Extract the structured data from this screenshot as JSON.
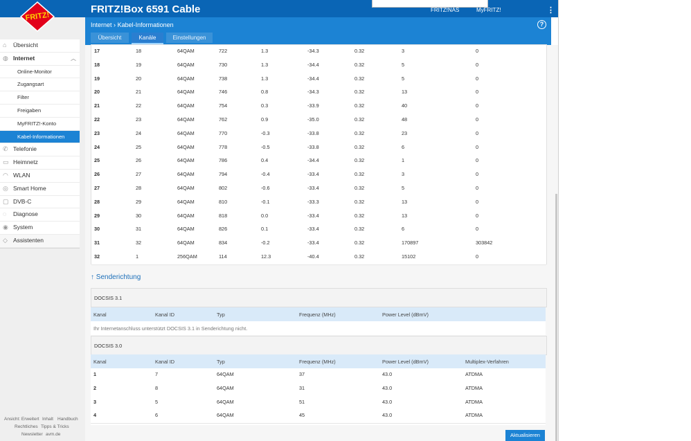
{
  "app": {
    "title": "FRITZ!Box 6591 Cable",
    "logo_text": "FRITZ!"
  },
  "header": {
    "fritznas": "FRITZ!NAS",
    "myfritz": "MyFRITZ!",
    "menu_icon": "⋮"
  },
  "breadcrumb": {
    "parent": "Internet",
    "separator": "›",
    "current": "Kabel-Informationen"
  },
  "help_label": "?",
  "tabs": [
    {
      "label": "Übersicht"
    },
    {
      "label": "Kanäle"
    },
    {
      "label": "Einstellungen"
    }
  ],
  "sidebar": {
    "items": [
      {
        "label": "Übersicht",
        "icon": "home-icon"
      },
      {
        "label": "Internet",
        "icon": "globe-icon"
      },
      {
        "label": "Online-Monitor"
      },
      {
        "label": "Zugangsart"
      },
      {
        "label": "Filter"
      },
      {
        "label": "Freigaben"
      },
      {
        "label": "MyFRITZ!-Konto"
      },
      {
        "label": "Kabel-Informationen"
      },
      {
        "label": "Telefonie",
        "icon": "phone-icon"
      },
      {
        "label": "Heimnetz",
        "icon": "network-icon"
      },
      {
        "label": "WLAN",
        "icon": "wifi-icon"
      },
      {
        "label": "Smart Home",
        "icon": "smart-home-icon"
      },
      {
        "label": "DVB-C",
        "icon": "tv-icon"
      },
      {
        "label": "Diagnose",
        "icon": "diagnose-icon"
      },
      {
        "label": "System",
        "icon": "system-icon"
      },
      {
        "label": "Assistenten",
        "icon": "wizard-icon"
      }
    ],
    "footer": {
      "ansicht": "Ansicht: Erweitert",
      "inhalt": "Inhalt",
      "handbuch": "Handbuch",
      "rechtliches": "Rechtliches",
      "tipps": "Tipps & Tricks",
      "newsletter": "Newsletter",
      "avm": "avm.de"
    }
  },
  "downstream": {
    "rows": [
      [
        "17",
        "18",
        "64QAM",
        "722",
        "1.3",
        "-34.3",
        "0.32",
        "3",
        "0"
      ],
      [
        "18",
        "19",
        "64QAM",
        "730",
        "1.3",
        "-34.4",
        "0.32",
        "5",
        "0"
      ],
      [
        "19",
        "20",
        "64QAM",
        "738",
        "1.3",
        "-34.4",
        "0.32",
        "5",
        "0"
      ],
      [
        "20",
        "21",
        "64QAM",
        "746",
        "0.8",
        "-34.3",
        "0.32",
        "13",
        "0"
      ],
      [
        "21",
        "22",
        "64QAM",
        "754",
        "0.3",
        "-33.9",
        "0.32",
        "40",
        "0"
      ],
      [
        "22",
        "23",
        "64QAM",
        "762",
        "0.9",
        "-35.0",
        "0.32",
        "48",
        "0"
      ],
      [
        "23",
        "24",
        "64QAM",
        "770",
        "-0.3",
        "-33.8",
        "0.32",
        "23",
        "0"
      ],
      [
        "24",
        "25",
        "64QAM",
        "778",
        "-0.5",
        "-33.8",
        "0.32",
        "6",
        "0"
      ],
      [
        "25",
        "26",
        "64QAM",
        "786",
        "0.4",
        "-34.4",
        "0.32",
        "1",
        "0"
      ],
      [
        "26",
        "27",
        "64QAM",
        "794",
        "-0.4",
        "-33.4",
        "0.32",
        "3",
        "0"
      ],
      [
        "27",
        "28",
        "64QAM",
        "802",
        "-0.6",
        "-33.4",
        "0.32",
        "5",
        "0"
      ],
      [
        "28",
        "29",
        "64QAM",
        "810",
        "-0.1",
        "-33.3",
        "0.32",
        "13",
        "0"
      ],
      [
        "29",
        "30",
        "64QAM",
        "818",
        "0.0",
        "-33.4",
        "0.32",
        "13",
        "0"
      ],
      [
        "30",
        "31",
        "64QAM",
        "826",
        "0.1",
        "-33.4",
        "0.32",
        "6",
        "0"
      ],
      [
        "31",
        "32",
        "64QAM",
        "834",
        "-0.2",
        "-33.4",
        "0.32",
        "170897",
        "303842"
      ],
      [
        "32",
        "1",
        "256QAM",
        "114",
        "12.3",
        "-40.4",
        "0.32",
        "15102",
        "0"
      ]
    ]
  },
  "upstream": {
    "title": "↑ Senderichtung",
    "docsis31": {
      "label": "DOCSIS 3.1",
      "headers": [
        "Kanal",
        "Kanal ID",
        "Typ",
        "Frequenz (MHz)",
        "Power Level (dBmV)"
      ],
      "note": "Ihr Internetanschluss unterstützt DOCSIS 3.1 in Senderichtung nicht."
    },
    "docsis30": {
      "label": "DOCSIS 3.0",
      "headers": [
        "Kanal",
        "Kanal ID",
        "Typ",
        "Frequenz (MHz)",
        "Power Level (dBmV)",
        "Multiplex-Verfahren"
      ],
      "rows": [
        [
          "1",
          "7",
          "64QAM",
          "37",
          "43.0",
          "ATDMA"
        ],
        [
          "2",
          "8",
          "64QAM",
          "31",
          "43.0",
          "ATDMA"
        ],
        [
          "3",
          "5",
          "64QAM",
          "51",
          "43.0",
          "ATDMA"
        ],
        [
          "4",
          "6",
          "64QAM",
          "45",
          "43.0",
          "ATDMA"
        ]
      ]
    }
  },
  "buttons": {
    "refresh": "Aktualisieren"
  }
}
